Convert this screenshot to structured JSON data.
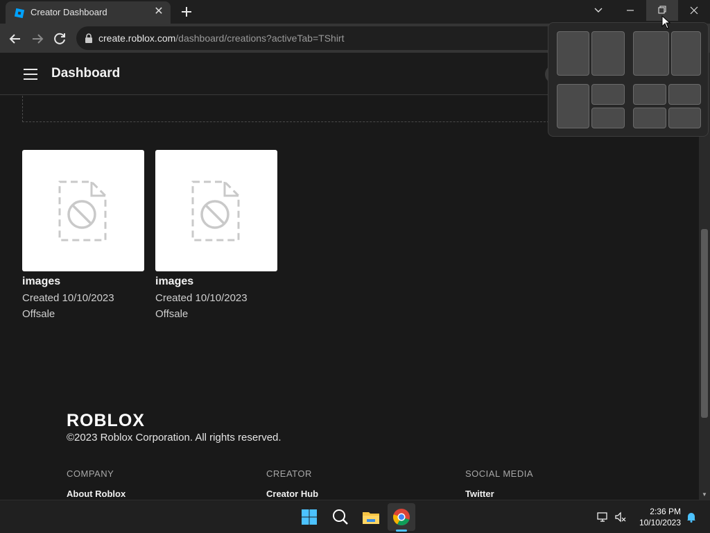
{
  "browser": {
    "tab_title": "Creator Dashboard",
    "url_host": "create.roblox.com",
    "url_path": "/dashboard/creations?activeTab=TShirt"
  },
  "header": {
    "title": "Dashboard"
  },
  "creations": [
    {
      "name": "images",
      "created": "Created 10/10/2023",
      "status": "Offsale"
    },
    {
      "name": "images",
      "created": "Created 10/10/2023",
      "status": "Offsale"
    }
  ],
  "footer": {
    "logo": "ROBLOX",
    "copyright": "©2023 Roblox Corporation. All rights reserved.",
    "columns": [
      {
        "heading": "COMPANY",
        "link": "About Roblox"
      },
      {
        "heading": "CREATOR",
        "link": "Creator Hub"
      },
      {
        "heading": "SOCIAL MEDIA",
        "link": "Twitter"
      }
    ]
  },
  "taskbar": {
    "time": "2:36 PM",
    "date": "10/10/2023"
  },
  "colors": {
    "accent": "#4cc2ff",
    "page_bg": "#191919",
    "chrome_bg": "#353535"
  }
}
